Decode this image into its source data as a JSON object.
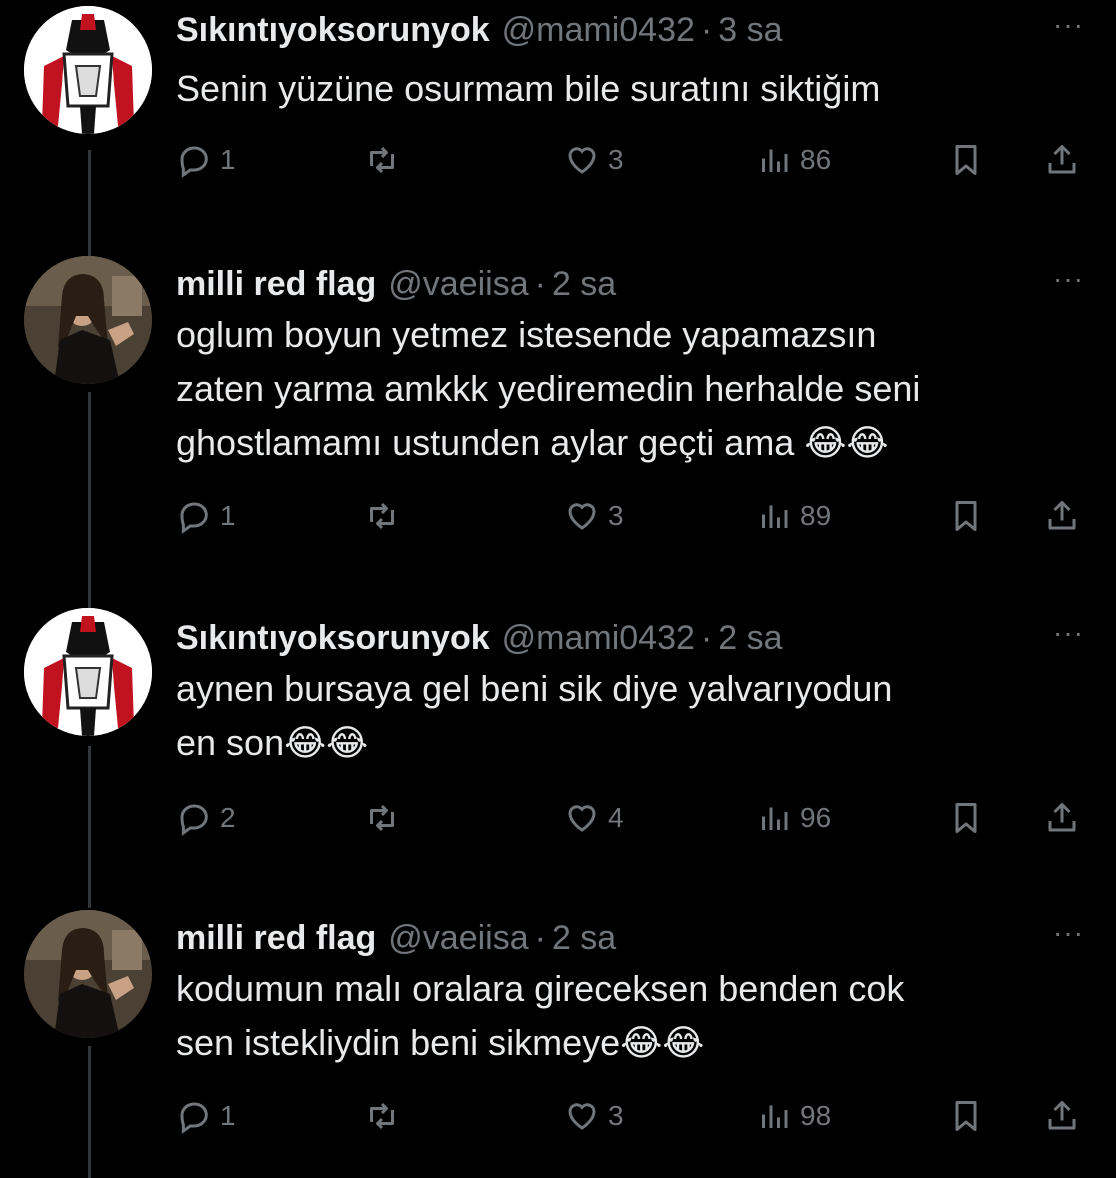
{
  "tweets": [
    {
      "name": "Sıkıntıyoksorunyok",
      "handle": "@mami0432",
      "time": "3 sa",
      "lines": [
        "Senin yüzüne osurmam bile suratını siktiğim"
      ],
      "avatar": "superhero-avatar",
      "stats": {
        "replies": "1",
        "likes": "3",
        "views": "86"
      }
    },
    {
      "name": "milli red flag",
      "handle": "@vaeiisa",
      "time": "2 sa",
      "lines": [
        "oglum boyun yetmez istesende yapamazsın",
        "zaten yarma amkkk yediremedin herhalde seni",
        "ghostlamamı ustunden aylar geçti ama 😂😂"
      ],
      "avatar": "woman-photo-avatar",
      "stats": {
        "replies": "1",
        "likes": "3",
        "views": "89"
      }
    },
    {
      "name": "Sıkıntıyoksorunyok",
      "handle": "@mami0432",
      "time": "2 sa",
      "lines": [
        "aynen bursaya gel beni sik diye yalvarıyodun",
        "en son😂😂"
      ],
      "avatar": "superhero-avatar",
      "stats": {
        "replies": "2",
        "likes": "4",
        "views": "96"
      }
    },
    {
      "name": "milli red flag",
      "handle": "@vaeiisa",
      "time": "2 sa",
      "lines": [
        "kodumun malı oralara gireceksen benden cok",
        "sen istekliydin beni sikmeye😂😂"
      ],
      "avatar": "woman-photo-avatar",
      "stats": {
        "replies": "1",
        "likes": "3",
        "views": "98"
      }
    }
  ],
  "separator": "·",
  "more_glyph": "···",
  "colors": {
    "background": "#000000",
    "text": "#e7e9ea",
    "muted": "#71767b",
    "thread_line": "#333639"
  }
}
